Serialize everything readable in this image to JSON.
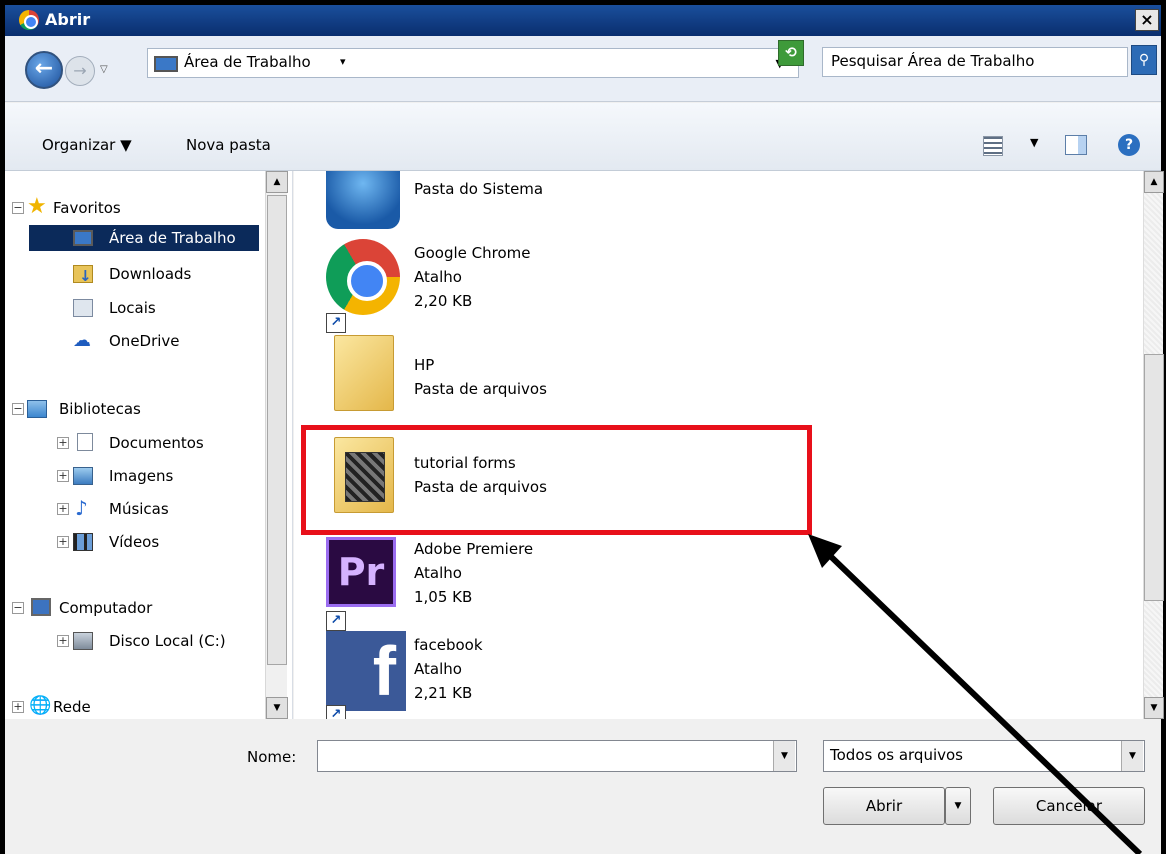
{
  "window": {
    "title": "Abrir",
    "close_label": "×"
  },
  "address": {
    "location": "Área de Trabalho",
    "search_placeholder": "Pesquisar Área de Trabalho"
  },
  "toolbar": {
    "organize_label": "Organizar ▼",
    "new_folder_label": "Nova pasta",
    "help_label": "?"
  },
  "nav": {
    "favorites": {
      "label": "Favoritos",
      "items": [
        "Área de Trabalho",
        "Downloads",
        "Locais",
        "OneDrive"
      ]
    },
    "libraries": {
      "label": "Bibliotecas",
      "items": [
        "Documentos",
        "Imagens",
        "Músicas",
        "Vídeos"
      ]
    },
    "computer": {
      "label": "Computador",
      "items": [
        "Disco Local (C:)"
      ]
    },
    "network": {
      "label": "Rede"
    }
  },
  "files": [
    {
      "name": "Pasta do Sistema",
      "type": "",
      "size": "",
      "icon": "system-folder-icon"
    },
    {
      "name": "Google Chrome",
      "type": "Atalho",
      "size": "2,20 KB",
      "icon": "chrome-icon"
    },
    {
      "name": "HP",
      "type": "Pasta de arquivos",
      "size": "",
      "icon": "folder-icon"
    },
    {
      "name": "tutorial forms",
      "type": "Pasta de arquivos",
      "size": "",
      "icon": "folder-photo-icon"
    },
    {
      "name": "Adobe Premiere",
      "type": "Atalho",
      "size": "1,05 KB",
      "icon": "premiere-icon"
    },
    {
      "name": "facebook",
      "type": "Atalho",
      "size": "2,21 KB",
      "icon": "facebook-icon"
    }
  ],
  "bottom": {
    "name_label": "Nome:",
    "name_value": "",
    "file_type": "Todos os arquivos",
    "open_label": "Abrir",
    "cancel_label": "Cancelar"
  },
  "icons": {
    "premiere_text": "Pr",
    "facebook_text": "f"
  },
  "colors": {
    "highlight": "#e8101a",
    "selection": "#0b2a5a",
    "titlebar": "#1a4f9c"
  }
}
